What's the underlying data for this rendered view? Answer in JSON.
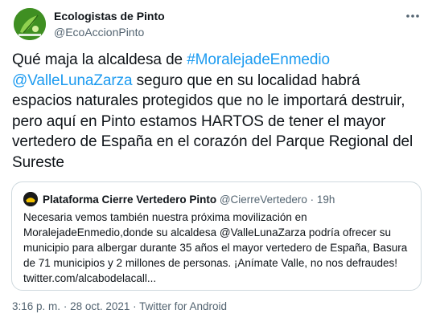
{
  "author": {
    "display_name": "Ecologistas de Pinto",
    "handle": "@EcoAccionPinto",
    "avatar_icon": "ecologistas-logo"
  },
  "more_icon": "more-horizontal-icon",
  "tweet": {
    "t1": "Qué maja la alcaldesa de ",
    "hashtag": "#MoralejadeEnmedio",
    "mention": "@ValleLunaZarza",
    "t2": " seguro que en su localidad habrá espacios naturales protegidos que no le importará destruir, pero aquí en Pinto estamos HARTOS de tener el mayor vertedero de España en el corazón del Parque Regional del Sureste"
  },
  "quote": {
    "display_name": "Plataforma Cierre Vertedero Pinto",
    "handle": "@CierreVertedero",
    "separator": "·",
    "time": "19h",
    "line1": "Necesaria vemos también nuestra próxima movilización en",
    "line2": "MoralejadeEnmedio,donde su alcaldesa @ValleLunaZarza podría ofrecer su",
    "line3": "municipio para albergar durante 35 años el mayor vertedero de España, Basura",
    "line4": "de 71 municipios y 2 millones de personas. ¡Anímate Valle, no nos defraudes!",
    "line5": "twitter.com/alcabodelacall..."
  },
  "meta": {
    "time": "3:16 p. m.",
    "sep1": "·",
    "date": "28 oct. 2021",
    "sep2": "·",
    "source": "Twitter for Android"
  },
  "colors": {
    "link": "#1d9bf0",
    "secondary_text": "#536471",
    "border": "#cfd9de",
    "avatar_green": "#3f8f22"
  }
}
